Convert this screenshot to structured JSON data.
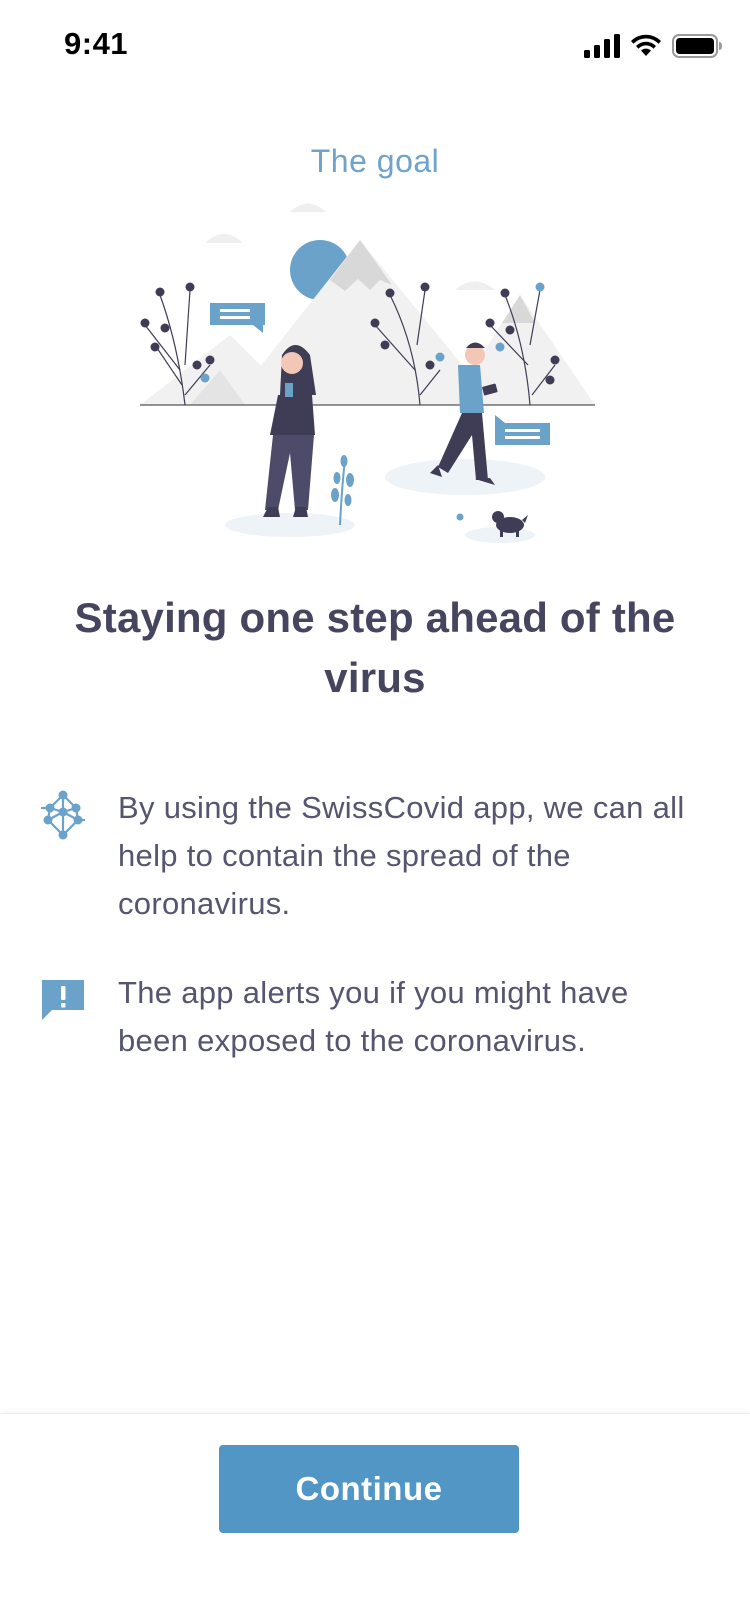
{
  "status_bar": {
    "time": "9:41",
    "icons": [
      "cellular-signal-icon",
      "wifi-icon",
      "battery-icon"
    ]
  },
  "onboarding": {
    "section_label": "The goal",
    "illustration": "people-with-phones-outdoors-illustration",
    "headline": "Staying one step ahead of the virus",
    "items": [
      {
        "icon": "network-nodes-icon",
        "text": "By using the SwissCovid app, we can all help to contain the spread of the coronavirus."
      },
      {
        "icon": "alert-message-icon",
        "text": "The app alerts you if you might have been exposed to the coronavirus."
      }
    ]
  },
  "footer": {
    "continue_label": "Continue"
  },
  "colors": {
    "accent": "#5196c4",
    "label_blue": "#6fa3cc",
    "heading": "#45455f",
    "body_text": "#55556f"
  }
}
